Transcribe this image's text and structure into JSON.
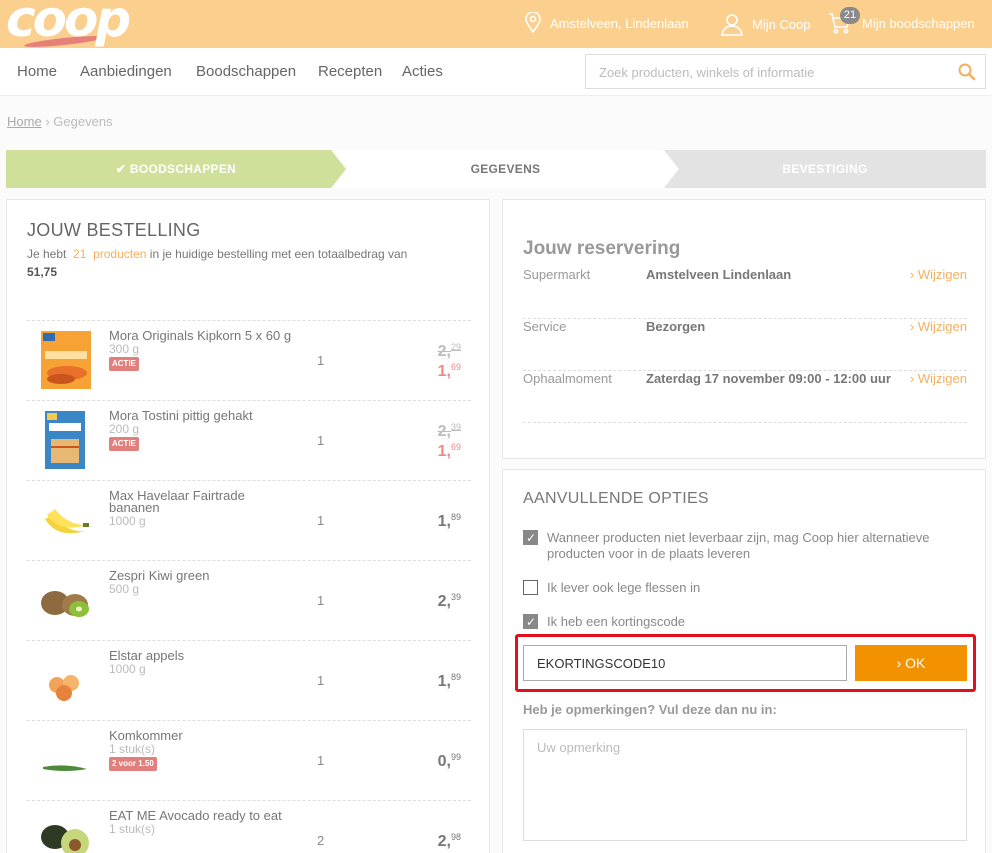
{
  "header": {
    "logo": "coop",
    "location": "Amstelveen, Lindenlaan",
    "account": "Mijn Coop",
    "cart_count": "21",
    "cart_label": "Mijn boodschappen"
  },
  "nav": {
    "items": [
      "Home",
      "Aanbiedingen",
      "Boodschappen",
      "Recepten",
      "Acties"
    ],
    "search_placeholder": "Zoek producten, winkels of informatie"
  },
  "breadcrumb": {
    "home": "Home",
    "separator": "›",
    "current": "Gegevens"
  },
  "steps": [
    "✔ BOODSCHAPPEN",
    "GEGEVENS",
    "BEVESTIGING"
  ],
  "order": {
    "title": "JOUW BESTELLING",
    "summary_pre": "Je hebt",
    "count": "21",
    "summary_link": "producten",
    "summary_post": "in je huidige bestelling met een totaalbedrag van",
    "total": "51,75",
    "items": [
      {
        "name": "Mora Originals Kipkorn 5 x 60 g",
        "size": "300 g",
        "tag": "ACTIE",
        "qty": "1",
        "old_int": "2,",
        "old_dec": "29",
        "price_int": "1,",
        "price_dec": "69",
        "icon": "kipkorn-box"
      },
      {
        "name": "Mora Tostini pittig gehakt",
        "size": "200 g",
        "tag": "ACTIE",
        "qty": "1",
        "old_int": "2,",
        "old_dec": "39",
        "price_int": "1,",
        "price_dec": "69",
        "icon": "tostini-box"
      },
      {
        "name": "Max Havelaar Fairtrade bananen",
        "size": "1000 g",
        "tag": "",
        "qty": "1",
        "old_int": "",
        "old_dec": "",
        "price_int": "1,",
        "price_dec": "89",
        "icon": "banana"
      },
      {
        "name": "Zespri Kiwi green",
        "size": "500 g",
        "tag": "",
        "qty": "1",
        "old_int": "",
        "old_dec": "",
        "price_int": "2,",
        "price_dec": "39",
        "icon": "kiwi"
      },
      {
        "name": "Elstar appels",
        "size": "1000 g",
        "tag": "",
        "qty": "1",
        "old_int": "",
        "old_dec": "",
        "price_int": "1,",
        "price_dec": "89",
        "icon": "apples"
      },
      {
        "name": "Komkommer",
        "size": "1 stuk(s)",
        "tag": "2 voor 1.50",
        "qty": "1",
        "old_int": "",
        "old_dec": "",
        "price_int": "0,",
        "price_dec": "99",
        "icon": "cucumber"
      },
      {
        "name": "EAT ME Avocado ready to eat",
        "size": "1 stuk(s)",
        "tag": "",
        "qty": "2",
        "old_int": "",
        "old_dec": "",
        "price_int": "2,",
        "price_dec": "98",
        "icon": "avocado"
      }
    ]
  },
  "reservation": {
    "title": "Jouw reservering",
    "change_label": "› Wijzigen",
    "rows": [
      {
        "label": "Supermarkt",
        "value": "Amstelveen Lindenlaan"
      },
      {
        "label": "Service",
        "value": "Bezorgen"
      },
      {
        "label": "Ophaalmoment",
        "value": "Zaterdag 17 november 09:00 - 12:00 uur"
      }
    ]
  },
  "options": {
    "title": "AANVULLENDE OPTIES",
    "alternatives": "Wanneer producten niet leverbaar zijn, mag Coop hier alternatieve producten voor in de plaats leveren",
    "bottles": "Ik lever ook lege flessen in",
    "discount": "Ik heb een kortingscode",
    "discount_code": "EKORTINGSCODE10",
    "ok_label": "› OK",
    "remarks_label": "Heb je opmerkingen? Vul deze dan nu in:",
    "remarks_placeholder": "Uw opmerking"
  },
  "colors": {
    "header": "#fbd08f",
    "accent": "#f39200",
    "highlight": "#e3101b",
    "step_done": "#cfe09a",
    "sale": "#e98a85"
  }
}
